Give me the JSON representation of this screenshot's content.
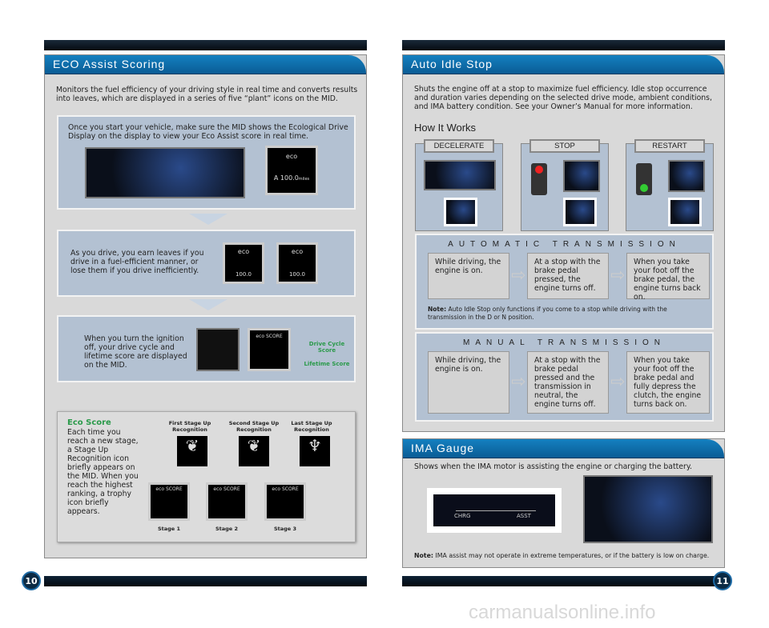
{
  "left": {
    "title": "ECO Assist Scoring",
    "intro": "Monitors the fuel efficiency of your driving style in real time and converts results into leaves, which are displayed in a series of five “plant” icons on the MID.",
    "step1": "Once you start your vehicle, make sure the MID shows the Ecological Drive Display on the display to view your Eco Assist score in real time.",
    "step2": "As you drive, you earn leaves if you drive in a fuel-efficient manner, or lose them if you drive inefficiently.",
    "step3": "When you turn the ignition off, your drive cycle and lifetime score are displayed on the MID.",
    "mid_eco": "eco",
    "mid_value": "100.0",
    "mid_unit": "miles",
    "mid_a": "A",
    "mid_score": "eco SCORE",
    "drive_cycle": "Drive Cycle Score",
    "lifetime": "Lifetime Score",
    "eco_score_title": "Eco Score",
    "eco_score_text": "Each time you reach a new stage, a Stage Up Recognition icon briefly appears on the MID. When you reach the highest ranking, a trophy icon briefly appears.",
    "recognitions": [
      "First Stage Up Recognition",
      "Second Stage Up Recognition",
      "Last Stage Up Recognition"
    ],
    "stages": [
      "Stage 1",
      "Stage 2",
      "Stage 3"
    ],
    "page": "10"
  },
  "right": {
    "title": "Auto Idle Stop",
    "intro": "Shuts the engine off at a stop to maximize fuel efficiency. Idle stop occurrence and duration varies depending on the selected drive mode, ambient conditions, and IMA battery condition. See your Owner’s Manual for more information.",
    "how": "How It Works",
    "tabs": [
      "DECELERATE",
      "STOP",
      "RESTART"
    ],
    "auto": {
      "title": "AUTOMATIC TRANSMISSION",
      "steps": [
        "While driving, the engine is on.",
        "At a stop with the brake pedal pressed, the engine turns off.",
        "When you take your foot off the brake pedal, the engine turns back on."
      ],
      "note_label": "Note:",
      "note": "Auto Idle Stop only functions if you come to a stop while driving with the transmission in the D or N position."
    },
    "manual": {
      "title": "MANUAL TRANSMISSION",
      "steps": [
        "While driving, the engine is on.",
        "At a stop with the brake pedal pressed and the transmission in neutral, the engine turns off.",
        "When you take your foot off the brake pedal and fully depress the clutch, the engine turns back on."
      ]
    },
    "ima": {
      "title": "IMA Gauge",
      "text": "Shows when the IMA motor is assisting the engine or charging the battery.",
      "chrg": "CHRG",
      "asst": "ASST",
      "note_label": "Note:",
      "note": "IMA assist may not operate in extreme temperatures, or if the battery is low on charge."
    },
    "page": "11"
  },
  "watermark": "carmanualsonline.info"
}
